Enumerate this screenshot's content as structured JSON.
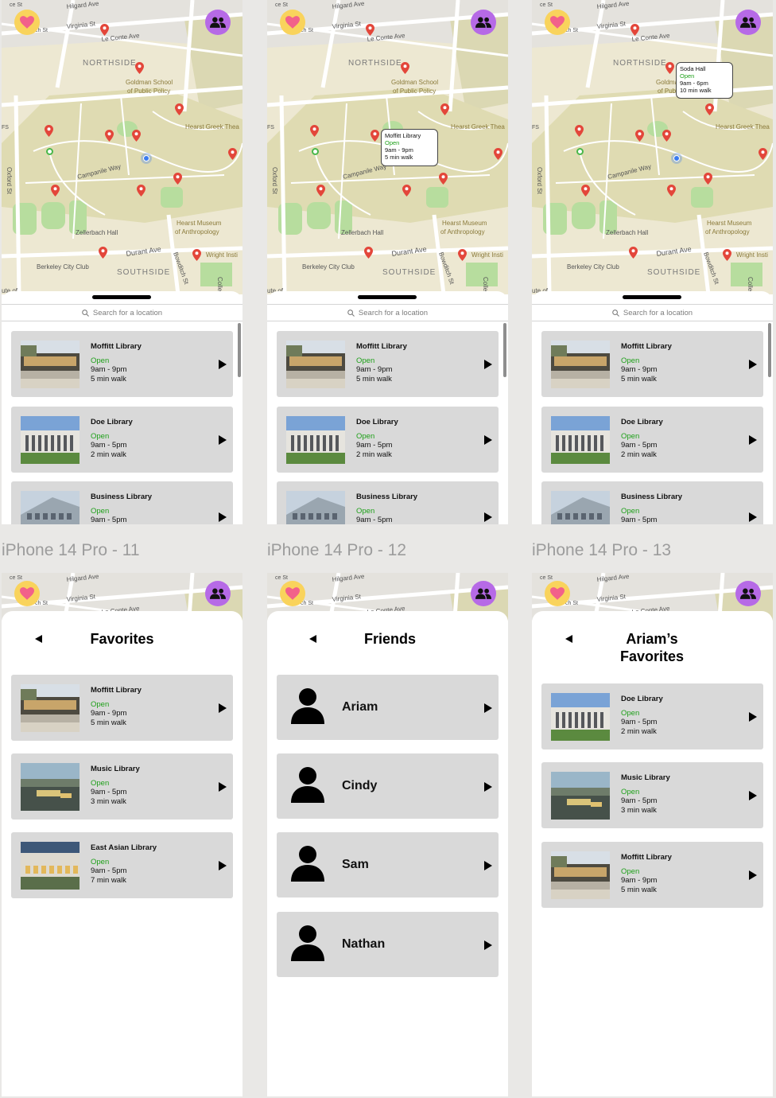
{
  "frame_labels": [
    "iPhone 14 Pro - 11",
    "iPhone 14 Pro - 12",
    "iPhone 14 Pro - 13"
  ],
  "search": {
    "placeholder": "Search for a location"
  },
  "map_labels": {
    "hilgard": "Hilgard Ave",
    "virginia": "Virginia St",
    "leconte": "Le Conte Ave",
    "northside": "NORTHSIDE",
    "goldman": "Goldman School",
    "goldman2": "of Public Policy",
    "greek": "Hearst Greek Thea",
    "campanile": "Campanile Way",
    "oxford": "Oxford St",
    "hearst_museum": "Hearst Museum",
    "hearst_museum2": "of Anthropology",
    "zellerbach": "Zellerbach Hall",
    "durant": "Durant Ave",
    "wright": "Wright Insti",
    "city_club": "Berkeley City Club",
    "southside": "SOUTHSIDE",
    "bowditch": "Bowditch St",
    "colle": "Colle",
    "ute": "ute of",
    "ce_st": "ce St",
    "ch_st": "ch St",
    "fs": "FS"
  },
  "map_cards": [
    {
      "name": "Moffitt Library",
      "status": "Open",
      "hours": "9am - 9pm",
      "walk": "5 min walk"
    },
    {
      "name": "Doe Library",
      "status": "Open",
      "hours": "9am - 5pm",
      "walk": "2 min walk"
    },
    {
      "name": "Business Library",
      "status": "Open",
      "hours": "9am - 5pm",
      "walk": ""
    }
  ],
  "popup_moffitt": {
    "name": "Moffitt Library",
    "status": "Open",
    "hours": "9am - 9pm",
    "walk": "5 min walk"
  },
  "popup_soda": {
    "name": "Soda Hall",
    "status": "Open",
    "hours": "9am - 6pm",
    "walk": "10 min walk"
  },
  "favorites": {
    "title": "Favorites",
    "items": [
      {
        "name": "Moffitt Library",
        "status": "Open",
        "hours": "9am - 9pm",
        "walk": "5 min walk"
      },
      {
        "name": "Music Library",
        "status": "Open",
        "hours": "9am - 5pm",
        "walk": "3 min walk"
      },
      {
        "name": "East Asian Library",
        "status": "Open",
        "hours": "9am - 5pm",
        "walk": "7 min walk"
      }
    ]
  },
  "friends": {
    "title": "Friends",
    "items": [
      "Ariam",
      "Cindy",
      "Sam",
      "Nathan"
    ]
  },
  "ariam_favorites": {
    "title_line1": "Ariam’s",
    "title_line2": "Favorites",
    "items": [
      {
        "name": "Doe Library",
        "status": "Open",
        "hours": "9am - 5pm",
        "walk": "2 min walk"
      },
      {
        "name": "Music Library",
        "status": "Open",
        "hours": "9am - 5pm",
        "walk": "3 min walk"
      },
      {
        "name": "Moffitt Library",
        "status": "Open",
        "hours": "9am - 9pm",
        "walk": "5 min walk"
      }
    ]
  },
  "colors": {
    "open_green": "#1fa01a",
    "card_bg": "#d9d9d9",
    "heart_bg": "#f9d35c",
    "heart": "#f2618a",
    "friends_bg": "#b66ae6",
    "pin": "#e3463a",
    "user_dot": "#3b7bef"
  }
}
